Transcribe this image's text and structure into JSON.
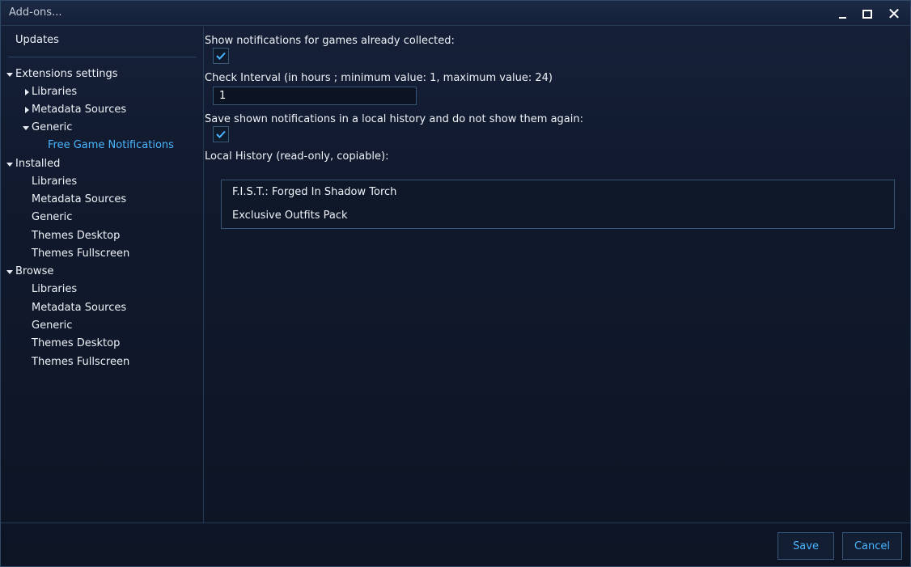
{
  "window": {
    "title": "Add-ons..."
  },
  "sidebar": {
    "updates": "Updates",
    "extensions_settings": {
      "label": "Extensions settings",
      "libraries": "Libraries",
      "metadata_sources": "Metadata Sources",
      "generic": {
        "label": "Generic",
        "free_game_notifications": "Free Game Notifications"
      }
    },
    "installed": {
      "label": "Installed",
      "items": [
        "Libraries",
        "Metadata Sources",
        "Generic",
        "Themes Desktop",
        "Themes Fullscreen"
      ]
    },
    "browse": {
      "label": "Browse",
      "items": [
        "Libraries",
        "Metadata Sources",
        "Generic",
        "Themes Desktop",
        "Themes Fullscreen"
      ]
    }
  },
  "settings": {
    "show_collected_label": "Show notifications for games already collected:",
    "show_collected_checked": true,
    "check_interval_label": "Check Interval (in hours ; minimum value: 1, maximum value: 24)",
    "check_interval_value": "1",
    "save_history_label": "Save shown notifications in a local history and do not show them again:",
    "save_history_checked": true,
    "local_history_label": "Local History (read-only, copiable):",
    "local_history": [
      "F.I.S.T.: Forged In Shadow Torch",
      "Exclusive Outfits Pack"
    ]
  },
  "footer": {
    "save": "Save",
    "cancel": "Cancel"
  },
  "colors": {
    "accent": "#49b6ff",
    "background": "#111a2e",
    "border": "#355677"
  }
}
